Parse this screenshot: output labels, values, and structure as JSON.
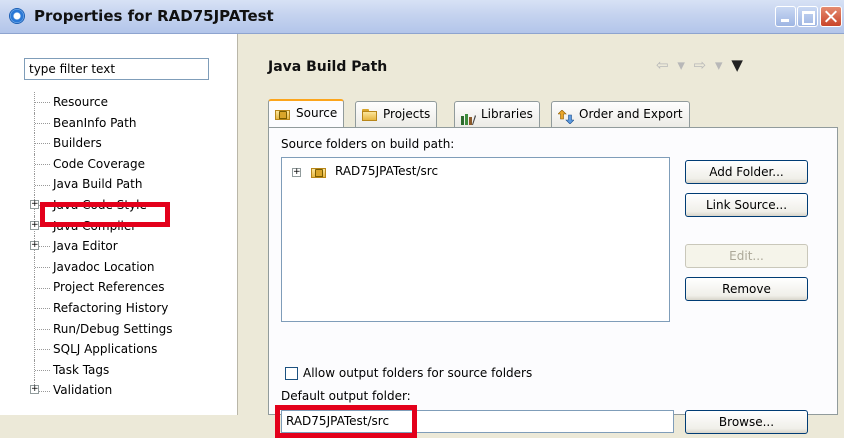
{
  "window": {
    "title": "Properties for RAD75JPATest",
    "icon": "eclipse-properties-icon"
  },
  "filter": {
    "value": "type filter text"
  },
  "tree": {
    "items": [
      {
        "label": "Resource",
        "expandable": false
      },
      {
        "label": "BeanInfo Path",
        "expandable": false
      },
      {
        "label": "Builders",
        "expandable": false
      },
      {
        "label": "Code Coverage",
        "expandable": false
      },
      {
        "label": "Java Build Path",
        "expandable": false,
        "selected": true
      },
      {
        "label": "Java Code Style",
        "expandable": true
      },
      {
        "label": "Java Compiler",
        "expandable": true
      },
      {
        "label": "Java Editor",
        "expandable": true
      },
      {
        "label": "Javadoc Location",
        "expandable": false
      },
      {
        "label": "Project References",
        "expandable": false
      },
      {
        "label": "Refactoring History",
        "expandable": false
      },
      {
        "label": "Run/Debug Settings",
        "expandable": false
      },
      {
        "label": "SQLJ Applications",
        "expandable": false
      },
      {
        "label": "Task Tags",
        "expandable": false
      },
      {
        "label": "Validation",
        "expandable": true
      }
    ]
  },
  "page": {
    "title": "Java Build Path",
    "nav": {
      "back": "⇦",
      "back_menu": "▾",
      "forward": "⇨",
      "forward_menu": "▾",
      "menu": "▼"
    }
  },
  "tabs": [
    {
      "label": "Source",
      "icon": "source-folder-icon",
      "active": true
    },
    {
      "label": "Projects",
      "icon": "projects-icon",
      "active": false
    },
    {
      "label": "Libraries",
      "icon": "libraries-icon",
      "active": false
    },
    {
      "label": "Order and Export",
      "icon": "order-export-icon",
      "active": false
    }
  ],
  "source": {
    "folders_label": "Source folders on build path:",
    "folders": [
      {
        "label": "RAD75JPATest/src",
        "expander": "+"
      }
    ],
    "buttons": {
      "add_folder": "Add Folder...",
      "link_source": "Link Source...",
      "edit": "Edit...",
      "remove": "Remove",
      "browse": "Browse..."
    },
    "allow_output_label": "Allow output folders for source folders",
    "allow_output_checked": false,
    "default_output_label": "Default output folder:",
    "default_output_value": "RAD75JPATest/src"
  },
  "colors": {
    "highlight": "#e3001b",
    "active_tab_accent": "#fca51c"
  }
}
